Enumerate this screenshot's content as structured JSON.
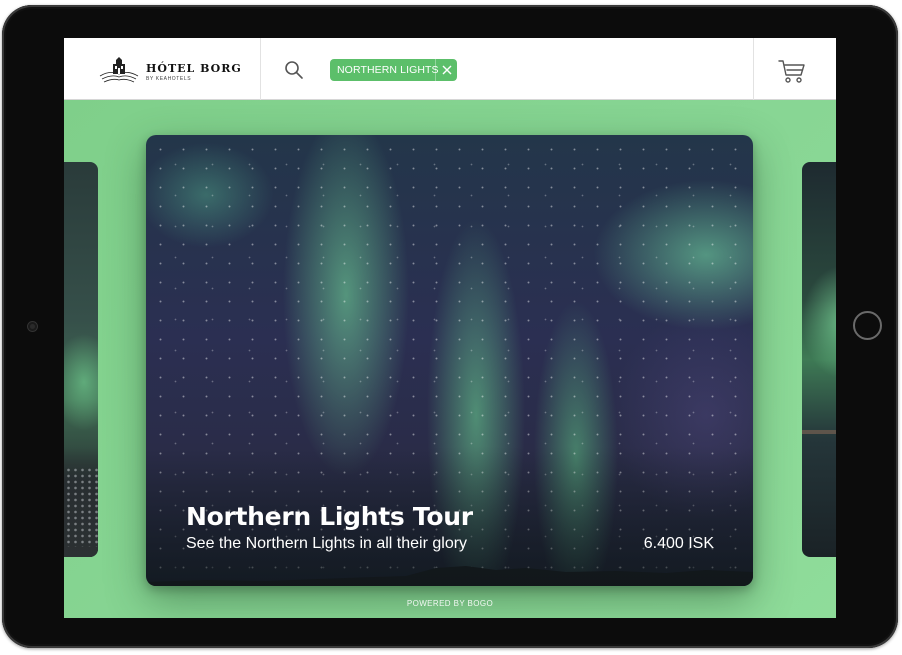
{
  "header": {
    "logo_title": "HÓTEL BORG",
    "logo_subtitle": "BY KEAHOTELS",
    "search_icon": "search-icon",
    "filter_chip": {
      "label": "NORTHERN LIGHTS",
      "close_icon": "close-icon"
    },
    "cart_icon": "cart-icon"
  },
  "carousel": {
    "main_card": {
      "title": "Northern Lights Tour",
      "description": "See the Northern Lights in all their glory",
      "price": "6.400 ISK"
    }
  },
  "footer": {
    "text": "POWERED BY BOGO"
  },
  "colors": {
    "accent": "#5cbf6a",
    "background": "#86d493",
    "bezel": "#0c0c0c"
  }
}
